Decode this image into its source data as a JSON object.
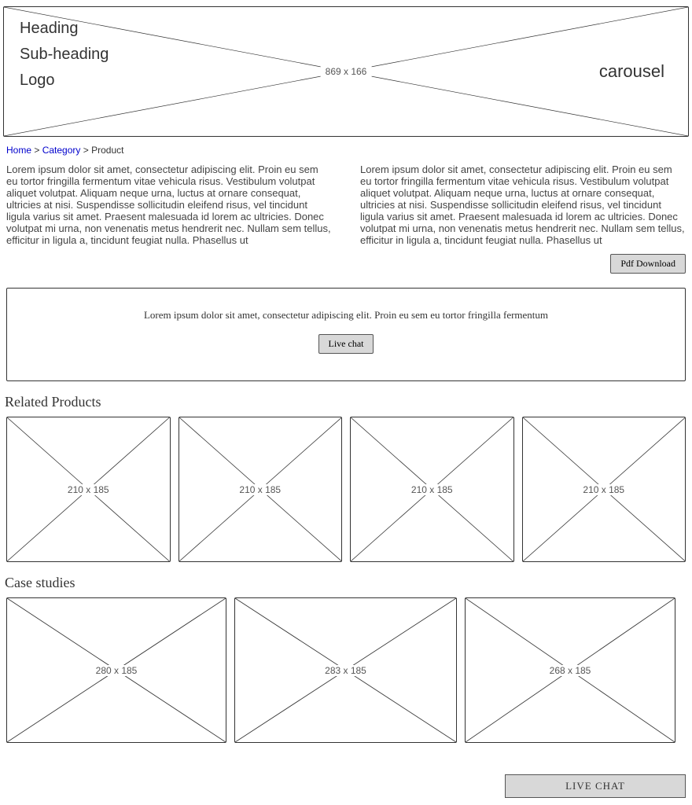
{
  "hero": {
    "heading": "Heading",
    "subheading": "Sub-heading",
    "logo": "Logo",
    "carousel_label": "carousel",
    "dim": "869 x 166"
  },
  "breadcrumb": {
    "home": "Home",
    "category": "Category",
    "product": "Product",
    "sep": " > "
  },
  "paragraphs": {
    "left": "Lorem ipsum dolor sit amet, consectetur adipiscing elit. Proin eu sem eu tortor fringilla fermentum vitae vehicula risus. Vestibulum volutpat aliquet volutpat. Aliquam neque urna, luctus at ornare consequat, ultricies at nisi. Suspendisse sollicitudin eleifend risus, vel tincidunt ligula varius sit amet. Praesent malesuada id lorem ac ultricies. Donec volutpat mi urna, non venenatis metus hendrerit nec. Nullam sem tellus, efficitur in ligula a, tincidunt feugiat nulla. Phasellus ut",
    "right": "Lorem ipsum dolor sit amet, consectetur adipiscing elit. Proin eu sem eu tortor fringilla fermentum vitae vehicula risus. Vestibulum volutpat aliquet volutpat. Aliquam neque urna, luctus at ornare consequat, ultricies at nisi. Suspendisse sollicitudin eleifend risus, vel tincidunt ligula varius sit amet. Praesent malesuada id lorem ac ultricies. Donec volutpat mi urna, non venenatis metus hendrerit nec. Nullam sem tellus, efficitur in ligula a, tincidunt feugiat nulla. Phasellus ut"
  },
  "buttons": {
    "pdf": "Pdf Download",
    "live_chat": "Live chat",
    "live_chat_bar": "LIVE CHAT"
  },
  "cta": {
    "text": "Lorem ipsum dolor sit amet, consectetur adipiscing elit. Proin eu sem eu tortor fringilla fermentum"
  },
  "sections": {
    "related": "Related Products",
    "case_studies": "Case studies"
  },
  "related": [
    {
      "dim": "210 x 185"
    },
    {
      "dim": "210 x 185"
    },
    {
      "dim": "210 x 185"
    },
    {
      "dim": "210 x 185"
    }
  ],
  "case_studies": [
    {
      "dim": "280 x 185"
    },
    {
      "dim": "283 x 185"
    },
    {
      "dim": "268 x 185"
    }
  ]
}
